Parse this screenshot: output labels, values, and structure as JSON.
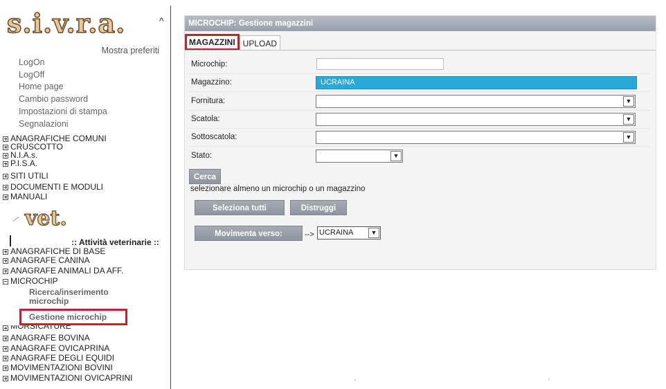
{
  "sidebar": {
    "logo": "s.i.v.r.a.",
    "favorites_link": "Mostra preferiti",
    "links": [
      "LogOn",
      "LogOff",
      "Home page",
      "Cambio password",
      "Impostazioni di stampa",
      "Segnalazioni"
    ],
    "tree_top": [
      "ANAGRAFICHE COMUNI",
      "CRUSCOTTO",
      "N.I.A.s.",
      "P.I.S.A.",
      "SITI UTILI",
      "DOCUMENTI E MODULI",
      "MANUALI"
    ],
    "vet_logo": "vet.",
    "section_title": ":: Attività veterinarie ::",
    "tree_vet_a": [
      "ANAGRAFICHE DI BASE",
      "ANAGRAFE CANINA",
      "ANAGRAFE ANIMALI DA AFF."
    ],
    "microchip_node": "MICROCHIP",
    "microchip_sub": [
      "Ricerca/inserimento microchip",
      "Gestione microchip"
    ],
    "tree_vet_b": [
      "MORSICATURE",
      "ANAGRAFE BOVINA",
      "ANAGRAFE OVICAPRINA",
      "ANAGRAFE DEGLI EQUIDI",
      "MOVIMENTAZIONI BOVINI",
      "MOVIMENTAZIONI OVICAPRINI"
    ]
  },
  "panel": {
    "title": "MICROCHIP: Gestione magazzini",
    "tabs": [
      "MAGAZZINI",
      "UPLOAD"
    ],
    "form": {
      "microchip_label": "Microchip:",
      "microchip_value": "",
      "magazzino_label": "Magazzino:",
      "magazzino_value": "UCRAINA",
      "fornitura_label": "Fornitura:",
      "scatola_label": "Scatola:",
      "sottoscatola_label": "Sottoscatola:",
      "stato_label": "Stato:"
    },
    "search_button": "Cerca",
    "info": "selezionare almeno un microchip o un magazzino",
    "select_all_button": "Seleziona tutti",
    "destroy_button": "Distruggi",
    "move_button": "Movimenta verso:",
    "move_arrow": "-->",
    "move_target": "UCRAINA"
  },
  "colors": {
    "highlight_border": "#c8202c",
    "selected_option": "#2aa8d8",
    "button_gray": "#9aa0a9"
  }
}
